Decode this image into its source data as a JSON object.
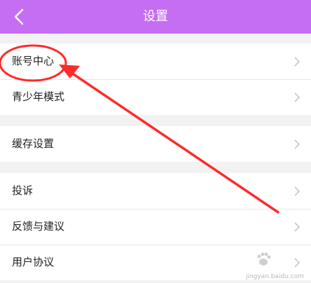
{
  "header": {
    "title": "设置",
    "back_icon": "chevron-left-icon",
    "background": "#c56ef4"
  },
  "sections": [
    {
      "items": [
        {
          "label": "账号中心"
        },
        {
          "label": "青少年模式"
        }
      ]
    },
    {
      "items": [
        {
          "label": "缓存设置"
        }
      ]
    },
    {
      "items": [
        {
          "label": "投诉"
        },
        {
          "label": "反馈与建议"
        },
        {
          "label": "用户协议"
        }
      ]
    }
  ],
  "row_chevron_icon": "chevron-right-icon",
  "annotation": {
    "color": "#ff2a2a"
  },
  "watermark": {
    "text": "jingyan.baidu.com"
  }
}
